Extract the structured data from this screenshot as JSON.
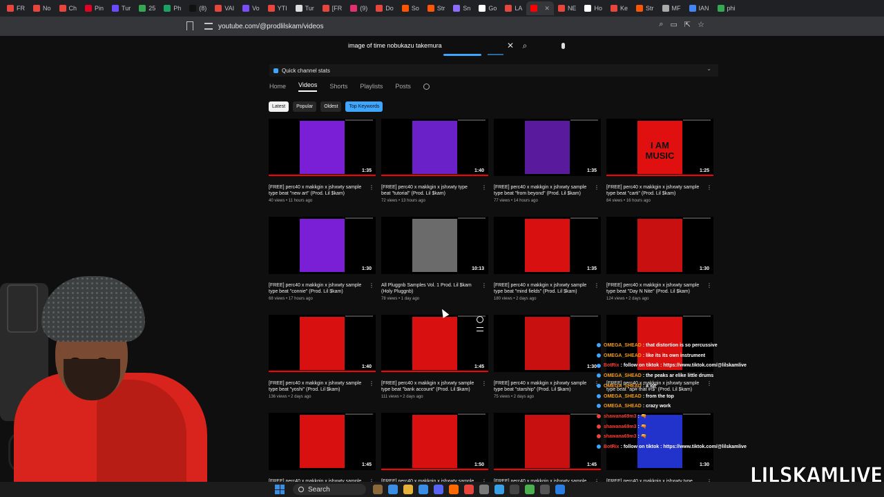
{
  "browser": {
    "tabs": [
      {
        "label": "FR",
        "color": "#e8453c"
      },
      {
        "label": "No",
        "color": "#e8453c"
      },
      {
        "label": "Ch",
        "color": "#e8453c"
      },
      {
        "label": "Pin",
        "color": "#e60023"
      },
      {
        "label": "Tur",
        "color": "#6b4bff"
      },
      {
        "label": "25",
        "color": "#34a853"
      },
      {
        "label": "Ph",
        "color": "#1aa260"
      },
      {
        "label": "(8)",
        "color": "#111111"
      },
      {
        "label": "VAI",
        "color": "#e8453c"
      },
      {
        "label": "Vo",
        "color": "#7b4dff"
      },
      {
        "label": "YTI",
        "color": "#e8453c"
      },
      {
        "label": "Tur",
        "color": "#dddddd"
      },
      {
        "label": "[FR",
        "color": "#e8453c"
      },
      {
        "label": "(9)",
        "color": "#e1306c"
      },
      {
        "label": "Do",
        "color": "#e8453c"
      },
      {
        "label": "So",
        "color": "#ff5500"
      },
      {
        "label": "Str",
        "color": "#ff5500"
      },
      {
        "label": "Sn",
        "color": "#8e6cff"
      },
      {
        "label": "Go",
        "color": "#ffffff"
      },
      {
        "label": "LA",
        "color": "#e8453c"
      },
      {
        "label": "",
        "color": "#ff0000",
        "active": true
      },
      {
        "label": "NE",
        "color": "#e8453c"
      },
      {
        "label": "Ho",
        "color": "#ffffff"
      },
      {
        "label": "Ke",
        "color": "#e8453c"
      },
      {
        "label": "Str",
        "color": "#ff5500"
      },
      {
        "label": "MF",
        "color": "#aaaaaa"
      },
      {
        "label": "IAN",
        "color": "#4285f4"
      },
      {
        "label": "phi",
        "color": "#34a853"
      }
    ],
    "url": "youtube.com/@prodlilskam/videos"
  },
  "youtube": {
    "search_query": "image of time nobukazu takemura",
    "quick_stats_label": "Quick channel stats",
    "channel_tabs": [
      "Home",
      "Videos",
      "Shorts",
      "Playlists",
      "Posts"
    ],
    "active_tab": "Videos",
    "filters": [
      "Latest",
      "Popular",
      "Oldest",
      "Top Keywords"
    ],
    "videos": [
      {
        "title": "[FREE] perc40 x makkgin x jshxwty sample type beat \"new art\" (Prod. Lil $kam)",
        "meta": "40 views • 11 hours ago",
        "duration": "1:35",
        "thumb": "#7a1fd6",
        "progress": 1.0
      },
      {
        "title": "[FREE] perc40 x makkgin x jshxwty type beat \"tutorial\" (Prod. Lil $kam)",
        "meta": "72 views • 13 hours ago",
        "duration": "1:40",
        "thumb": "#6a22c8",
        "progress": 1.0
      },
      {
        "title": "[FREE] perc40 x makkgin x jshxwty sample type beat \"from beyond\" (Prod. Lil $kam)",
        "meta": "77 views • 14 hours ago",
        "duration": "1:35",
        "thumb": "#5a1a9e",
        "progress": 0.0
      },
      {
        "title": "[FREE] perc40 x makkgin x jshxwty sample type beat \"carti\" (Prod. Lil $kam)",
        "meta": "84 views • 16 hours ago",
        "duration": "1:25",
        "thumb": "#e01010",
        "thumb_text": "I AM MUSIC",
        "progress": 1.0
      },
      {
        "title": "[FREE] perc40 x makkgin x jshxwty sample type beat \"connie\" (Prod. Lil $kam)",
        "meta": "68 views • 17 hours ago",
        "duration": "1:30",
        "thumb": "#7a1fd6",
        "progress": 0.0
      },
      {
        "title": "All Pluggnb Samples Vol. 1 Prod. Lil $kam (Holy Pluggnb)",
        "meta": "78 views • 1 day ago",
        "duration": "10:13",
        "thumb": "#6b6b6b",
        "progress": 0.0
      },
      {
        "title": "[FREE] perc40 x makkgin x jshxwty sample type beat \"mind fields\" (Prod. Lil $kam)",
        "meta": "180 views • 2 days ago",
        "duration": "1:35",
        "thumb": "#d81010",
        "progress": 0.0
      },
      {
        "title": "[FREE] perc40 x makkgin x jshxwty sample type beat \"Day N Nite\" (Prod. Lil $kam)",
        "meta": "124 views • 2 days ago",
        "duration": "1:30",
        "thumb": "#c81010",
        "progress": 0.0
      },
      {
        "title": "[FREE] perc40 x makkgin x jshxwty sample type beat \"yoshi\" (Prod. Lil $kam)",
        "meta": "136 views • 2 days ago",
        "duration": "1:40",
        "thumb": "#d81010",
        "progress": 1.0
      },
      {
        "title": "[FREE] perc40 x makkgin x jshxwty sample type beat \"bank account\" (Prod. Lil $kam)",
        "meta": "111 views • 2 days ago",
        "duration": "1:45",
        "thumb": "#d81010",
        "progress": 1.0
      },
      {
        "title": "[FREE] perc40 x makkgin x jshxwty sample type beat \"starship\" (Prod. Lil $kam)",
        "meta": "75 views • 2 days ago",
        "duration": "1:30",
        "thumb": "#c81010",
        "progress": 0.0
      },
      {
        "title": "[FREE] perc40 x makkgin x jshxwty sample type beat \"ap# that #!$\" (Prod. Lil $kam)",
        "meta": "",
        "duration": "",
        "thumb": "#d81010",
        "progress": 0.0
      },
      {
        "title": "[FREE] perc40 x makkgin x jshxwty sample",
        "meta": "",
        "duration": "1:45",
        "thumb": "#d81010",
        "progress": 0.0
      },
      {
        "title": "[FREE] perc40 x makkgin x jshxwty sample",
        "meta": "",
        "duration": "1:50",
        "thumb": "#d81010",
        "progress": 1.0
      },
      {
        "title": "[FREE] perc40 x makkgin x jshxwty sample",
        "meta": "",
        "duration": "1:45",
        "thumb": "#c81010",
        "progress": 1.0
      },
      {
        "title": "[FREE] perc40 x makkgin x jshxwty type beat",
        "meta": "",
        "duration": "1:30",
        "thumb": "#2233cc",
        "progress": 0.0
      }
    ]
  },
  "chat": [
    {
      "user": "OMEGA_SHEAD",
      "text": "that distortion is so percussive",
      "color": "#f39c12",
      "badge": "#3ea6ff"
    },
    {
      "user": "OMEGA_SHEAD",
      "text": "like its its own instrument",
      "color": "#f39c12",
      "badge": "#3ea6ff"
    },
    {
      "user": "BotRix",
      "text": "follow on tiktok : https://www.tiktok.com/@lilskamlive",
      "color": "#ff3b30",
      "badge": "#3ea6ff"
    },
    {
      "user": "OMEGA_SHEAD",
      "text": "the peaks ar elike little drums",
      "color": "#f39c12",
      "badge": "#3ea6ff"
    },
    {
      "user": "OMEGA_SHEAD",
      "text": "a lot",
      "color": "#f39c12",
      "badge": "#3ea6ff"
    },
    {
      "user": "OMEGA_SHEAD",
      "text": "from the top",
      "color": "#f39c12",
      "badge": "#3ea6ff"
    },
    {
      "user": "OMEGA_SHEAD",
      "text": "crazy work",
      "color": "#f39c12",
      "badge": "#3ea6ff"
    },
    {
      "user": "shawana69m3",
      "text": "🔫",
      "color": "#ff3b30",
      "badge": "#e8453c"
    },
    {
      "user": "shawana69m3",
      "text": "🔫",
      "color": "#ff3b30",
      "badge": "#e8453c"
    },
    {
      "user": "shawana69m3",
      "text": "🔫",
      "color": "#ff3b30",
      "badge": "#e8453c"
    },
    {
      "user": "BotRix",
      "text": "follow on tiktok : https://www.tiktok.com/@lilskamlive",
      "color": "#ff3b30",
      "badge": "#3ea6ff"
    }
  ],
  "watermark": "LILSKAMLIVE",
  "taskbar": {
    "search_label": "Search",
    "apps": [
      "#8a6a3a",
      "#3a8ee6",
      "#e8b33c",
      "#3a8ee6",
      "#5865f2",
      "#ff6a00",
      "#e8453c",
      "#7a7a7a",
      "#3aa0e6",
      "#444444",
      "#4caf50",
      "#555555",
      "#2a7de1"
    ]
  }
}
